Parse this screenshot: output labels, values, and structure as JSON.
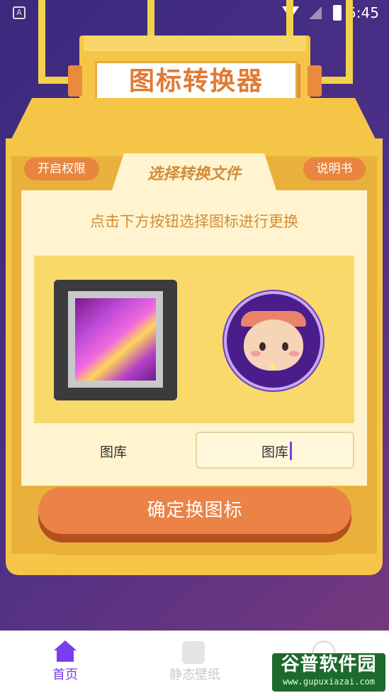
{
  "status_bar": {
    "time": "5:45",
    "left_icon": "A"
  },
  "app": {
    "title": "图标转换器",
    "tab_label": "选择转换文件",
    "left_pill": "开启权限",
    "right_pill": "说明书",
    "hint": "点击下方按钮选择图标进行更换",
    "gallery_left": "图库",
    "gallery_right": "图库",
    "confirm_button": "确定换图标"
  },
  "bottom_nav": {
    "items": [
      {
        "label": "首页",
        "icon": "home-icon",
        "active": true
      },
      {
        "label": "静态壁纸",
        "icon": "image-icon",
        "active": false
      },
      {
        "label": "",
        "icon": "user-icon",
        "active": false
      }
    ]
  },
  "watermark": {
    "title": "谷普软件园",
    "url": "www.gupuxiazai.com"
  },
  "colors": {
    "accent": "#eb8246",
    "nav_active": "#7b3dea",
    "panel": "#fff4cf",
    "machine": "#f5c548"
  }
}
